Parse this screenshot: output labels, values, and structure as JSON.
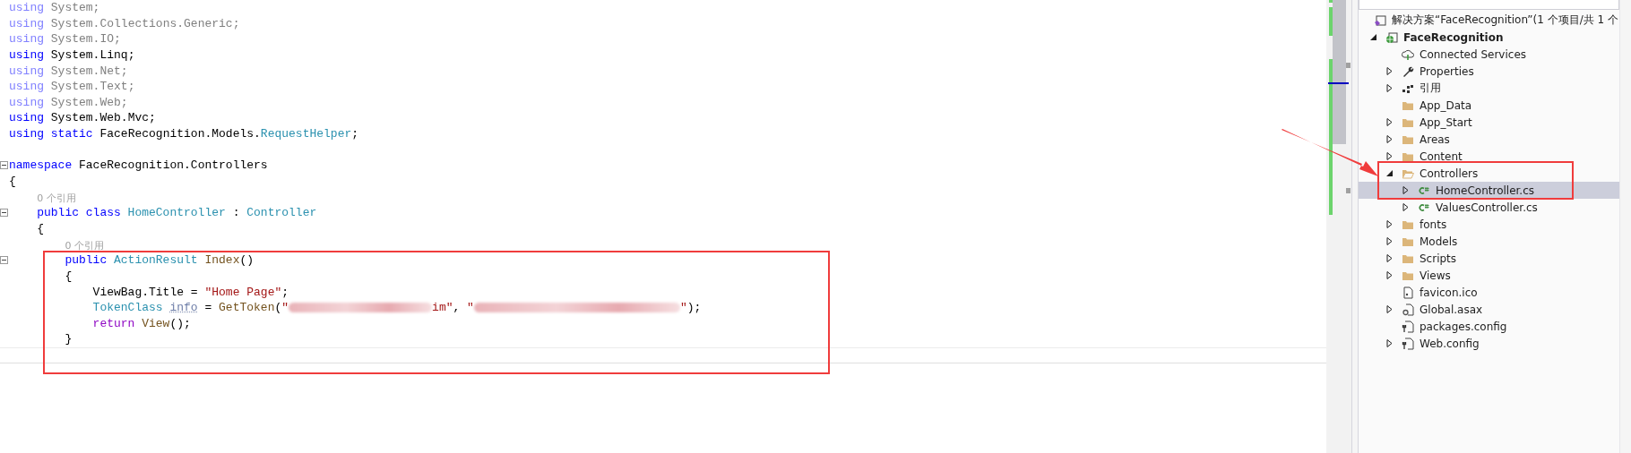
{
  "editor": {
    "lines": [
      {
        "kind": "code",
        "fold": false,
        "current": false,
        "tokens": [
          {
            "text": "using ",
            "kind": "kw-dim"
          },
          {
            "text": "System;",
            "kind": "dim"
          }
        ]
      },
      {
        "kind": "code",
        "fold": false,
        "current": false,
        "tokens": [
          {
            "text": "using ",
            "kind": "kw-dim"
          },
          {
            "text": "System.Collections.Generic;",
            "kind": "dim"
          }
        ]
      },
      {
        "kind": "code",
        "fold": false,
        "current": false,
        "tokens": [
          {
            "text": "using ",
            "kind": "kw-dim"
          },
          {
            "text": "System.IO;",
            "kind": "dim"
          }
        ]
      },
      {
        "kind": "code",
        "fold": false,
        "current": false,
        "tokens": [
          {
            "text": "using ",
            "kind": "kw"
          },
          {
            "text": "System.Linq;",
            "kind": "plain"
          }
        ]
      },
      {
        "kind": "code",
        "fold": false,
        "current": false,
        "tokens": [
          {
            "text": "using ",
            "kind": "kw-dim"
          },
          {
            "text": "System.Net;",
            "kind": "dim"
          }
        ]
      },
      {
        "kind": "code",
        "fold": false,
        "current": false,
        "tokens": [
          {
            "text": "using ",
            "kind": "kw-dim"
          },
          {
            "text": "System.Text;",
            "kind": "dim"
          }
        ]
      },
      {
        "kind": "code",
        "fold": false,
        "current": false,
        "tokens": [
          {
            "text": "using ",
            "kind": "kw-dim"
          },
          {
            "text": "System.Web;",
            "kind": "dim"
          }
        ]
      },
      {
        "kind": "code",
        "fold": false,
        "current": false,
        "tokens": [
          {
            "text": "using ",
            "kind": "kw"
          },
          {
            "text": "System.Web.Mvc;",
            "kind": "plain"
          }
        ]
      },
      {
        "kind": "code",
        "fold": false,
        "current": false,
        "tokens": [
          {
            "text": "using static ",
            "kind": "kw"
          },
          {
            "text": "FaceRecognition.Models.",
            "kind": "plain"
          },
          {
            "text": "RequestHelper",
            "kind": "type"
          },
          {
            "text": ";",
            "kind": "plain"
          }
        ]
      },
      {
        "kind": "blank",
        "fold": false,
        "current": false
      },
      {
        "kind": "code",
        "fold": true,
        "current": false,
        "tokens": [
          {
            "text": "namespace ",
            "kind": "kw"
          },
          {
            "text": "FaceRecognition.Controllers",
            "kind": "plain"
          }
        ]
      },
      {
        "kind": "code",
        "fold": false,
        "current": false,
        "tokens": [
          {
            "text": "{",
            "kind": "plain"
          }
        ],
        "children": [
          {
            "kind": "lens",
            "fold": false,
            "current": false,
            "tokens": [
              {
                "text": "0 个引用",
                "kind": "lens"
              }
            ]
          },
          {
            "kind": "code",
            "fold": true,
            "current": false,
            "tokens": [
              {
                "text": "public class ",
                "kind": "kw"
              },
              {
                "text": "HomeController",
                "kind": "type"
              },
              {
                "text": " : ",
                "kind": "plain"
              },
              {
                "text": "Controller",
                "kind": "type"
              }
            ]
          },
          {
            "kind": "code",
            "fold": false,
            "current": false,
            "tokens": [
              {
                "text": "{",
                "kind": "plain"
              }
            ],
            "children": [
              {
                "kind": "lens",
                "fold": false,
                "current": false,
                "tokens": [
                  {
                    "text": "0 个引用",
                    "kind": "lens"
                  }
                ]
              },
              {
                "kind": "code",
                "fold": true,
                "current": false,
                "tokens": [
                  {
                    "text": "public ",
                    "kind": "kw"
                  },
                  {
                    "text": "ActionResult ",
                    "kind": "type"
                  },
                  {
                    "text": "Index",
                    "kind": "method"
                  },
                  {
                    "text": "()",
                    "kind": "plain"
                  }
                ]
              },
              {
                "kind": "code",
                "fold": false,
                "current": false,
                "tokens": [
                  {
                    "text": "{",
                    "kind": "plain"
                  }
                ],
                "children": [
                  {
                    "kind": "code",
                    "fold": false,
                    "current": false,
                    "tokens": [
                      {
                        "text": "ViewBag.Title = ",
                        "kind": "plain"
                      },
                      {
                        "text": "\"Home Page\"",
                        "kind": "string"
                      },
                      {
                        "text": ";",
                        "kind": "plain"
                      }
                    ]
                  },
                  {
                    "kind": "code",
                    "fold": false,
                    "current": false,
                    "tokens": [
                      {
                        "text": "TokenClass ",
                        "kind": "type"
                      },
                      {
                        "text": "info",
                        "kind": "unused"
                      },
                      {
                        "text": " = ",
                        "kind": "plain"
                      },
                      {
                        "text": "GetToken",
                        "kind": "method"
                      },
                      {
                        "text": "(",
                        "kind": "plain"
                      },
                      {
                        "text": "\"",
                        "kind": "string"
                      },
                      {
                        "kind": "redacted"
                      },
                      {
                        "text": "im\"",
                        "kind": "string"
                      },
                      {
                        "text": ", ",
                        "kind": "plain"
                      },
                      {
                        "text": "\"",
                        "kind": "string"
                      },
                      {
                        "kind": "redacted"
                      },
                      {
                        "text": "\"",
                        "kind": "string"
                      },
                      {
                        "text": ");",
                        "kind": "plain"
                      }
                    ]
                  },
                  {
                    "kind": "code",
                    "fold": false,
                    "current": false,
                    "tokens": [
                      {
                        "text": "return ",
                        "kind": "ctrl"
                      },
                      {
                        "text": "View",
                        "kind": "method"
                      },
                      {
                        "text": "();",
                        "kind": "plain"
                      }
                    ]
                  }
                ]
              },
              {
                "kind": "code",
                "fold": false,
                "current": false,
                "tokens": [
                  {
                    "text": "}",
                    "kind": "plain"
                  }
                ]
              }
            ]
          }
        ]
      },
      {
        "kind": "blank",
        "fold": false,
        "current": true
      }
    ]
  },
  "solution_explorer": {
    "items": [
      {
        "label": "解决方案“FaceRecognition”(1 个项目/共 1 个",
        "kind": "solution",
        "selected": false,
        "bold": false,
        "children": [
          {
            "label": "FaceRecognition",
            "kind": "project",
            "expanded": true,
            "selected": false,
            "bold": true,
            "children": [
              {
                "label": "Connected Services",
                "kind": "connected",
                "selected": false,
                "bold": false
              },
              {
                "label": "Properties",
                "kind": "wrench",
                "expanded": false,
                "selected": false,
                "bold": false
              },
              {
                "label": "引用",
                "kind": "references",
                "expanded": false,
                "selected": false,
                "bold": false
              },
              {
                "label": "App_Data",
                "kind": "folder",
                "selected": false,
                "bold": false
              },
              {
                "label": "App_Start",
                "kind": "folder",
                "expanded": false,
                "selected": false,
                "bold": false
              },
              {
                "label": "Areas",
                "kind": "folder",
                "expanded": false,
                "selected": false,
                "bold": false
              },
              {
                "label": "Content",
                "kind": "folder",
                "expanded": false,
                "selected": false,
                "bold": false
              },
              {
                "label": "Controllers",
                "kind": "folder-open",
                "expanded": true,
                "selected": false,
                "bold": false,
                "children": [
                  {
                    "label": "HomeController.cs",
                    "kind": "csharp",
                    "expanded": false,
                    "selected": true,
                    "bold": false
                  },
                  {
                    "label": "ValuesController.cs",
                    "kind": "csharp",
                    "expanded": false,
                    "selected": false,
                    "bold": false
                  }
                ]
              },
              {
                "label": "fonts",
                "kind": "folder",
                "expanded": false,
                "selected": false,
                "bold": false
              },
              {
                "label": "Models",
                "kind": "folder",
                "expanded": false,
                "selected": false,
                "bold": false
              },
              {
                "label": "Scripts",
                "kind": "folder",
                "expanded": false,
                "selected": false,
                "bold": false
              },
              {
                "label": "Views",
                "kind": "folder",
                "expanded": false,
                "selected": false,
                "bold": false
              },
              {
                "label": "favicon.ico",
                "kind": "image-file",
                "selected": false,
                "bold": false
              },
              {
                "label": "Global.asax",
                "kind": "gear-file",
                "expanded": false,
                "selected": false,
                "bold": false
              },
              {
                "label": "packages.config",
                "kind": "config-file",
                "selected": false,
                "bold": false
              },
              {
                "label": "Web.config",
                "kind": "config-file",
                "expanded": false,
                "selected": false,
                "bold": false
              }
            ]
          }
        ]
      }
    ]
  }
}
